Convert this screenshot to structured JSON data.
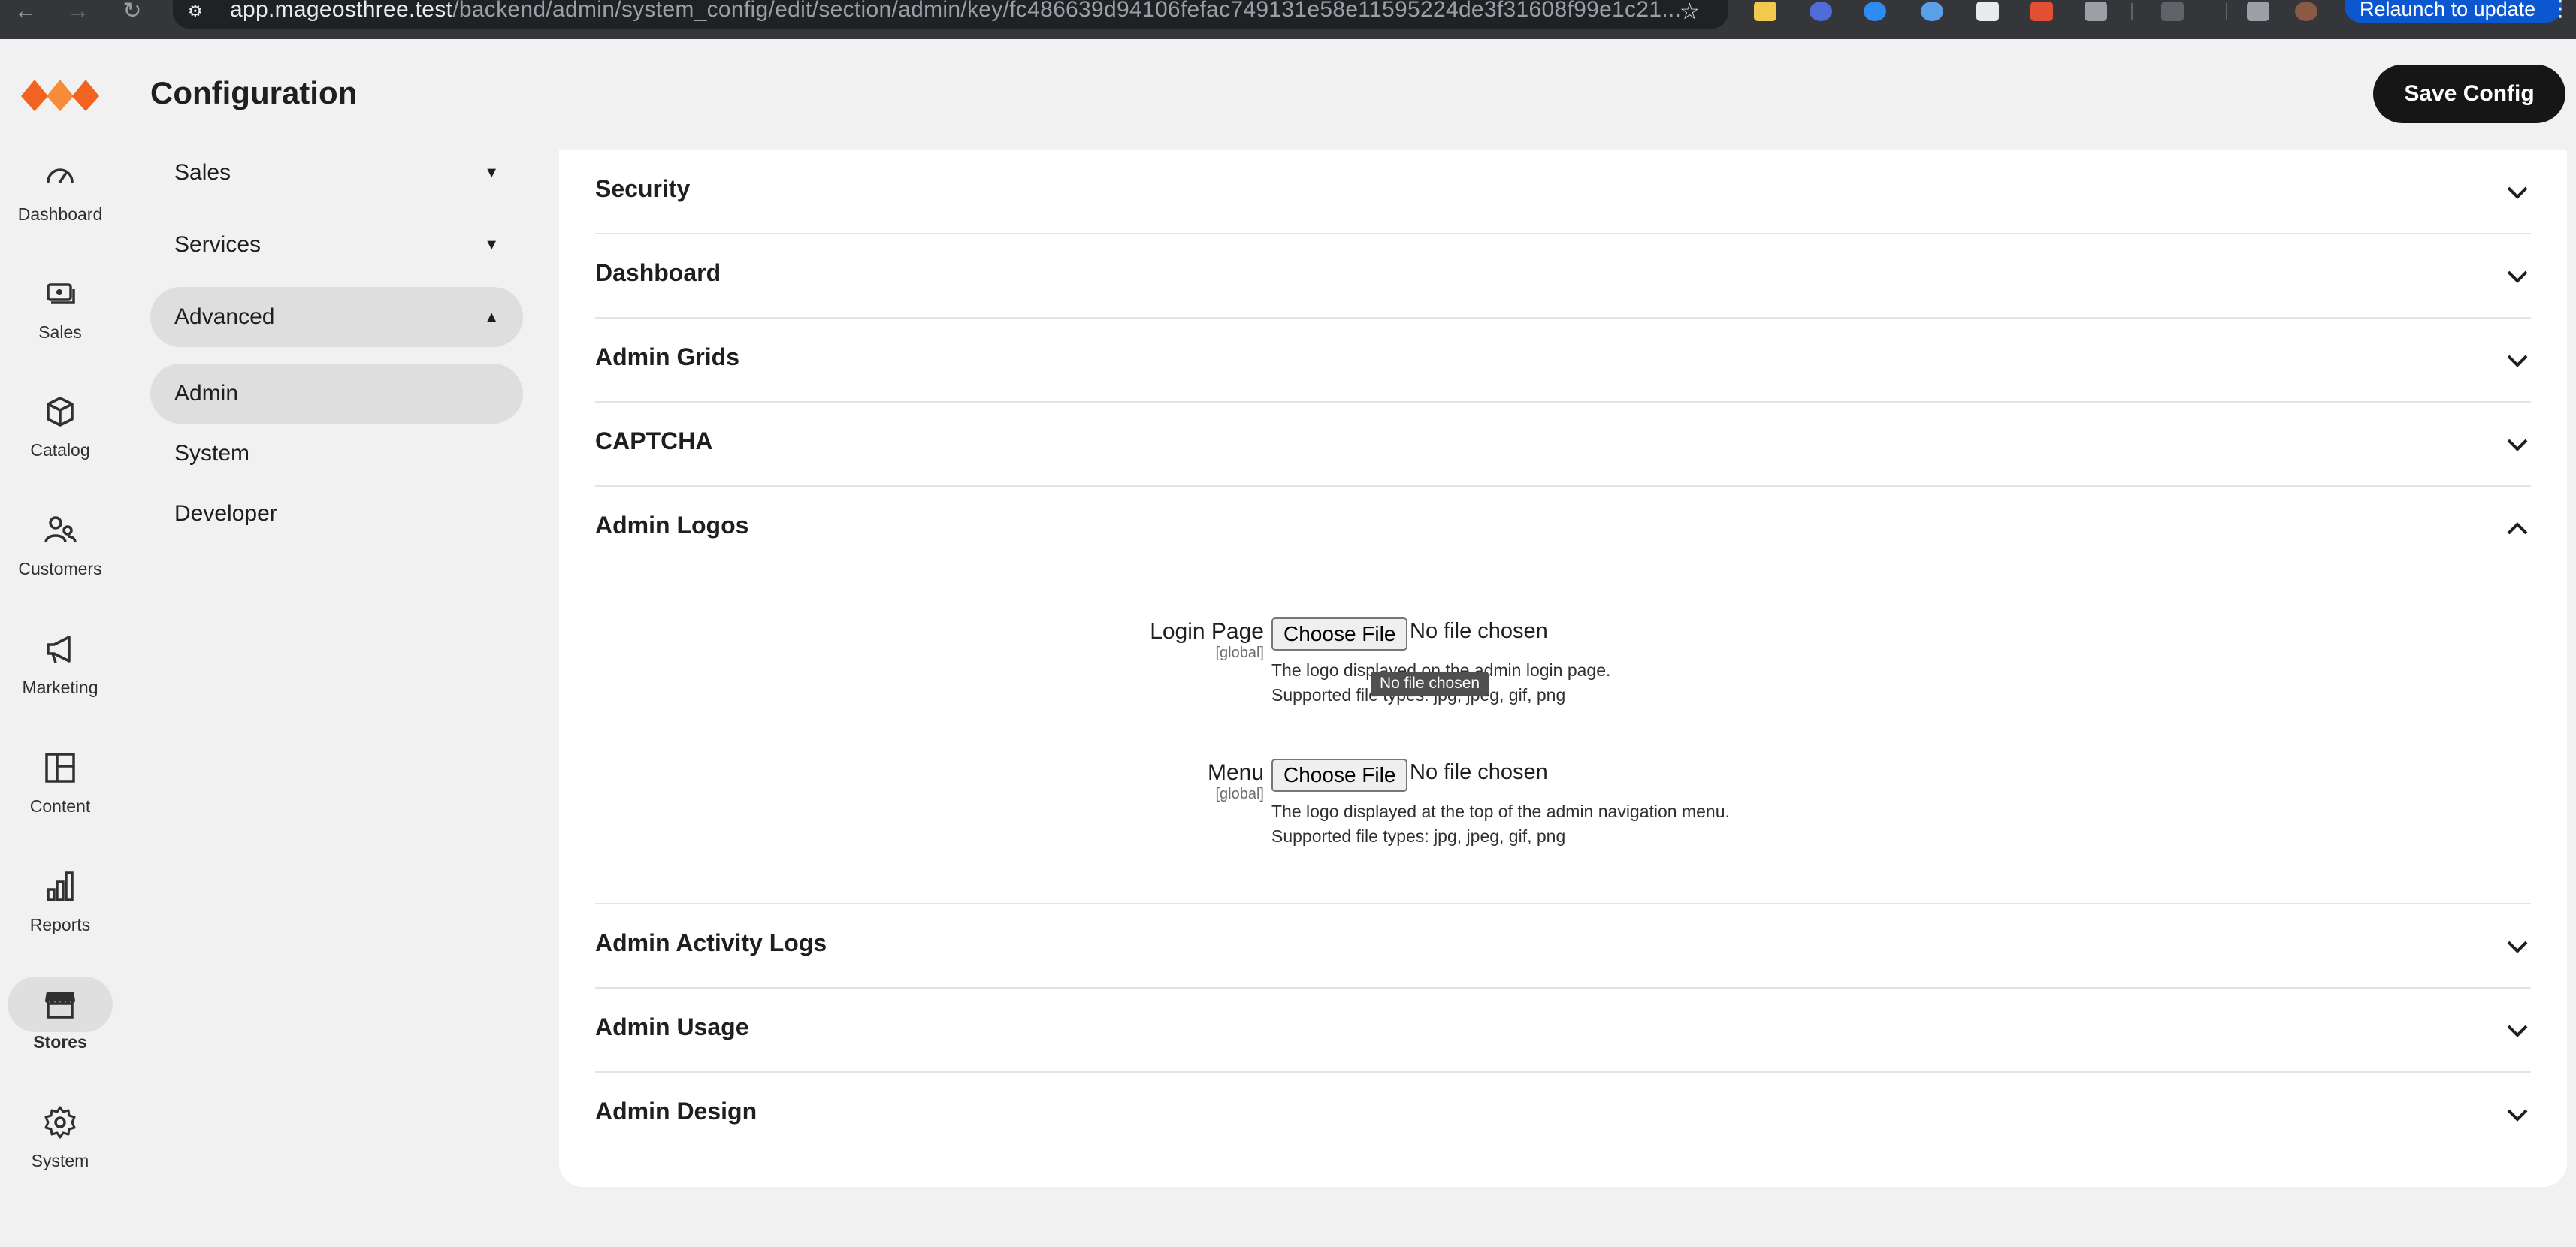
{
  "browser": {
    "url_host": "app.mageosthree.test",
    "url_path": "/backend/admin/system_config/edit/section/admin/key/fc486639d94106fefac749131e58e11595224de3f31608f99e1c21...",
    "relaunch_label": "Relaunch to update"
  },
  "rail": {
    "items": [
      {
        "label": "Dashboard",
        "icon": "dashboard-icon"
      },
      {
        "label": "Sales",
        "icon": "sales-icon"
      },
      {
        "label": "Catalog",
        "icon": "catalog-icon"
      },
      {
        "label": "Customers",
        "icon": "customers-icon"
      },
      {
        "label": "Marketing",
        "icon": "marketing-icon"
      },
      {
        "label": "Content",
        "icon": "content-icon"
      },
      {
        "label": "Reports",
        "icon": "reports-icon"
      },
      {
        "label": "Stores",
        "icon": "stores-icon",
        "active": true
      },
      {
        "label": "System",
        "icon": "system-icon"
      }
    ]
  },
  "header": {
    "title": "Configuration",
    "save_label": "Save Config"
  },
  "section_nav": {
    "groups": [
      {
        "label": "Sales",
        "expanded": false
      },
      {
        "label": "Services",
        "expanded": false
      },
      {
        "label": "Advanced",
        "expanded": true
      }
    ],
    "sub_items": [
      {
        "label": "Admin",
        "active": true
      },
      {
        "label": "System",
        "active": false
      },
      {
        "label": "Developer",
        "active": false
      }
    ]
  },
  "groups": [
    {
      "title": "Security",
      "open": false
    },
    {
      "title": "Dashboard",
      "open": false
    },
    {
      "title": "Admin Grids",
      "open": false
    },
    {
      "title": "CAPTCHA",
      "open": false
    },
    {
      "title": "Admin Logos",
      "open": true
    },
    {
      "title": "Admin Activity Logs",
      "open": false
    },
    {
      "title": "Admin Usage",
      "open": false
    },
    {
      "title": "Admin Design",
      "open": false
    }
  ],
  "logos": {
    "fields": [
      {
        "label": "Login Page",
        "scope": "[global]",
        "button": "Choose File",
        "status": "No file chosen",
        "note1": "The logo displayed on the admin login page.",
        "note2": "Supported file types: jpg, jpeg, gif, png"
      },
      {
        "label": "Menu",
        "scope": "[global]",
        "button": "Choose File",
        "status": "No file chosen",
        "note1": "The logo displayed at the top of the admin navigation menu.",
        "note2": "Supported file types: jpg, jpeg, gif, png"
      }
    ],
    "tooltip": "No file chosen"
  },
  "colors": {
    "accent": "#f26322",
    "save_button": "#161616",
    "expanded_bg": "#dedede"
  }
}
